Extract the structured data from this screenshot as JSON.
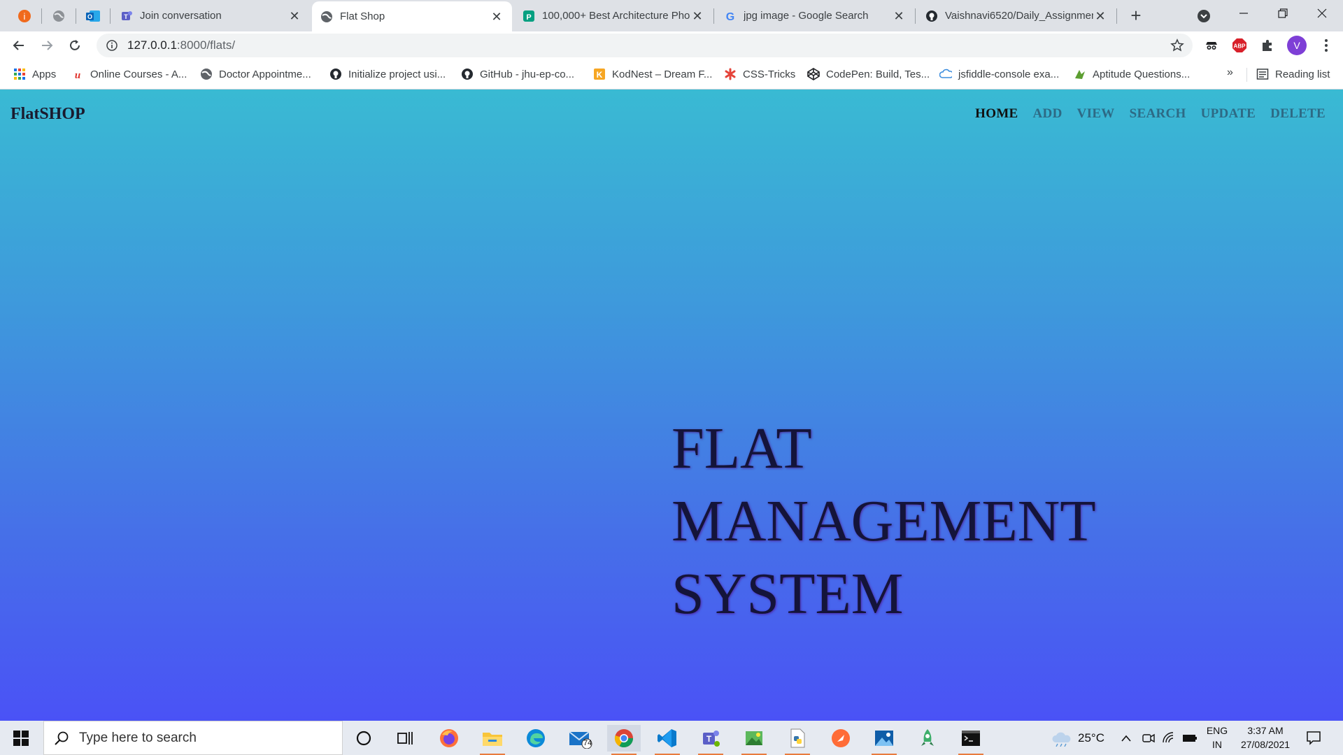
{
  "browser": {
    "tabs": [
      {
        "title": "Join conversation",
        "active": false
      },
      {
        "title": "Flat Shop",
        "active": true
      },
      {
        "title": "100,000+ Best Architecture Pho",
        "active": false
      },
      {
        "title": "jpg image - Google Search",
        "active": false
      },
      {
        "title": "Vaishnavi6520/Daily_Assignmen",
        "active": false
      }
    ],
    "close_glyph": "✕",
    "new_tab_glyph": "+",
    "address": {
      "host": "127.0.0.1",
      "path": ":8000/flats/"
    },
    "profile_initial": "V",
    "bookmarks": [
      {
        "label": "Apps",
        "icon": "apps-grid-icon"
      },
      {
        "label": "Online Courses - A...",
        "icon": "udemy-icon"
      },
      {
        "label": "Doctor Appointme...",
        "icon": "globe-icon"
      },
      {
        "label": "Initialize project usi...",
        "icon": "github-icon"
      },
      {
        "label": "GitHub - jhu-ep-co...",
        "icon": "github-icon"
      },
      {
        "label": "KodNest – Dream F...",
        "icon": "kodnest-icon"
      },
      {
        "label": "CSS-Tricks",
        "icon": "css-tricks-icon"
      },
      {
        "label": "CodePen: Build, Tes...",
        "icon": "codepen-icon"
      },
      {
        "label": "jsfiddle-console exa...",
        "icon": "jsfiddle-icon"
      },
      {
        "label": "Aptitude Questions...",
        "icon": "aptitude-icon"
      }
    ],
    "more_bookmarks_glyph": "»",
    "reading_list_label": "Reading list"
  },
  "page": {
    "brand": "FlatSHOP",
    "nav": [
      {
        "label": "HOME",
        "active": true
      },
      {
        "label": "ADD",
        "active": false
      },
      {
        "label": "VIEW",
        "active": false
      },
      {
        "label": "SEARCH",
        "active": false
      },
      {
        "label": "UPDATE",
        "active": false
      },
      {
        "label": "DELETE",
        "active": false
      }
    ],
    "hero_lines": [
      "FLAT",
      "MANAGEMENT",
      "SYSTEM"
    ],
    "colors": {
      "gradient_top": "#39bad3",
      "gradient_bottom": "#4a52f6",
      "nav_inactive": "#2d6a85",
      "nav_active": "#111111"
    }
  },
  "taskbar": {
    "search_placeholder": "Type here to search",
    "mail_badge": "74",
    "weather": "25°C",
    "lang_top": "ENG",
    "lang_bottom": "IN",
    "time": "3:37 AM",
    "date": "27/08/2021"
  }
}
